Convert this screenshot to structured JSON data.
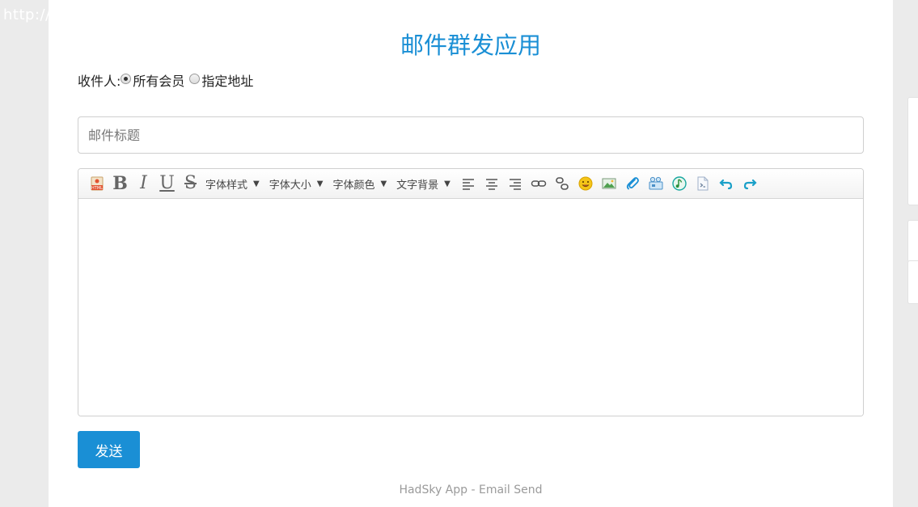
{
  "background_url_text": "http://",
  "page": {
    "title": "邮件群发应用",
    "accent_color": "#1a8fd5"
  },
  "recipients": {
    "label": "收件人:",
    "options": [
      {
        "label": "所有会员",
        "checked": true
      },
      {
        "label": "指定地址",
        "checked": false
      }
    ]
  },
  "subject": {
    "placeholder": "邮件标题",
    "value": ""
  },
  "toolbar": {
    "buttons": [
      {
        "icon": "html-source-icon"
      },
      {
        "icon": "bold-icon",
        "glyph": "B"
      },
      {
        "icon": "italic-icon",
        "glyph": "I"
      },
      {
        "icon": "underline-icon",
        "glyph": "U"
      },
      {
        "icon": "strikethrough-icon",
        "glyph": "S"
      }
    ],
    "dropdowns": [
      {
        "label": "字体样式",
        "arrow": "▼"
      },
      {
        "label": "字体大小",
        "arrow": "▼"
      },
      {
        "label": "字体颜色",
        "arrow": "▼"
      },
      {
        "label": "文字背景",
        "arrow": "▼"
      }
    ],
    "tools": [
      "align-left-icon",
      "align-center-icon",
      "align-right-icon",
      "link-icon",
      "unlink-icon",
      "emoji-icon",
      "image-icon",
      "attachment-icon",
      "video-icon",
      "music-icon",
      "code-icon",
      "undo-icon",
      "redo-icon"
    ]
  },
  "editor": {
    "content": ""
  },
  "send_button": {
    "label": "发送"
  },
  "footer": {
    "text": "HadSky App - Email Send"
  }
}
